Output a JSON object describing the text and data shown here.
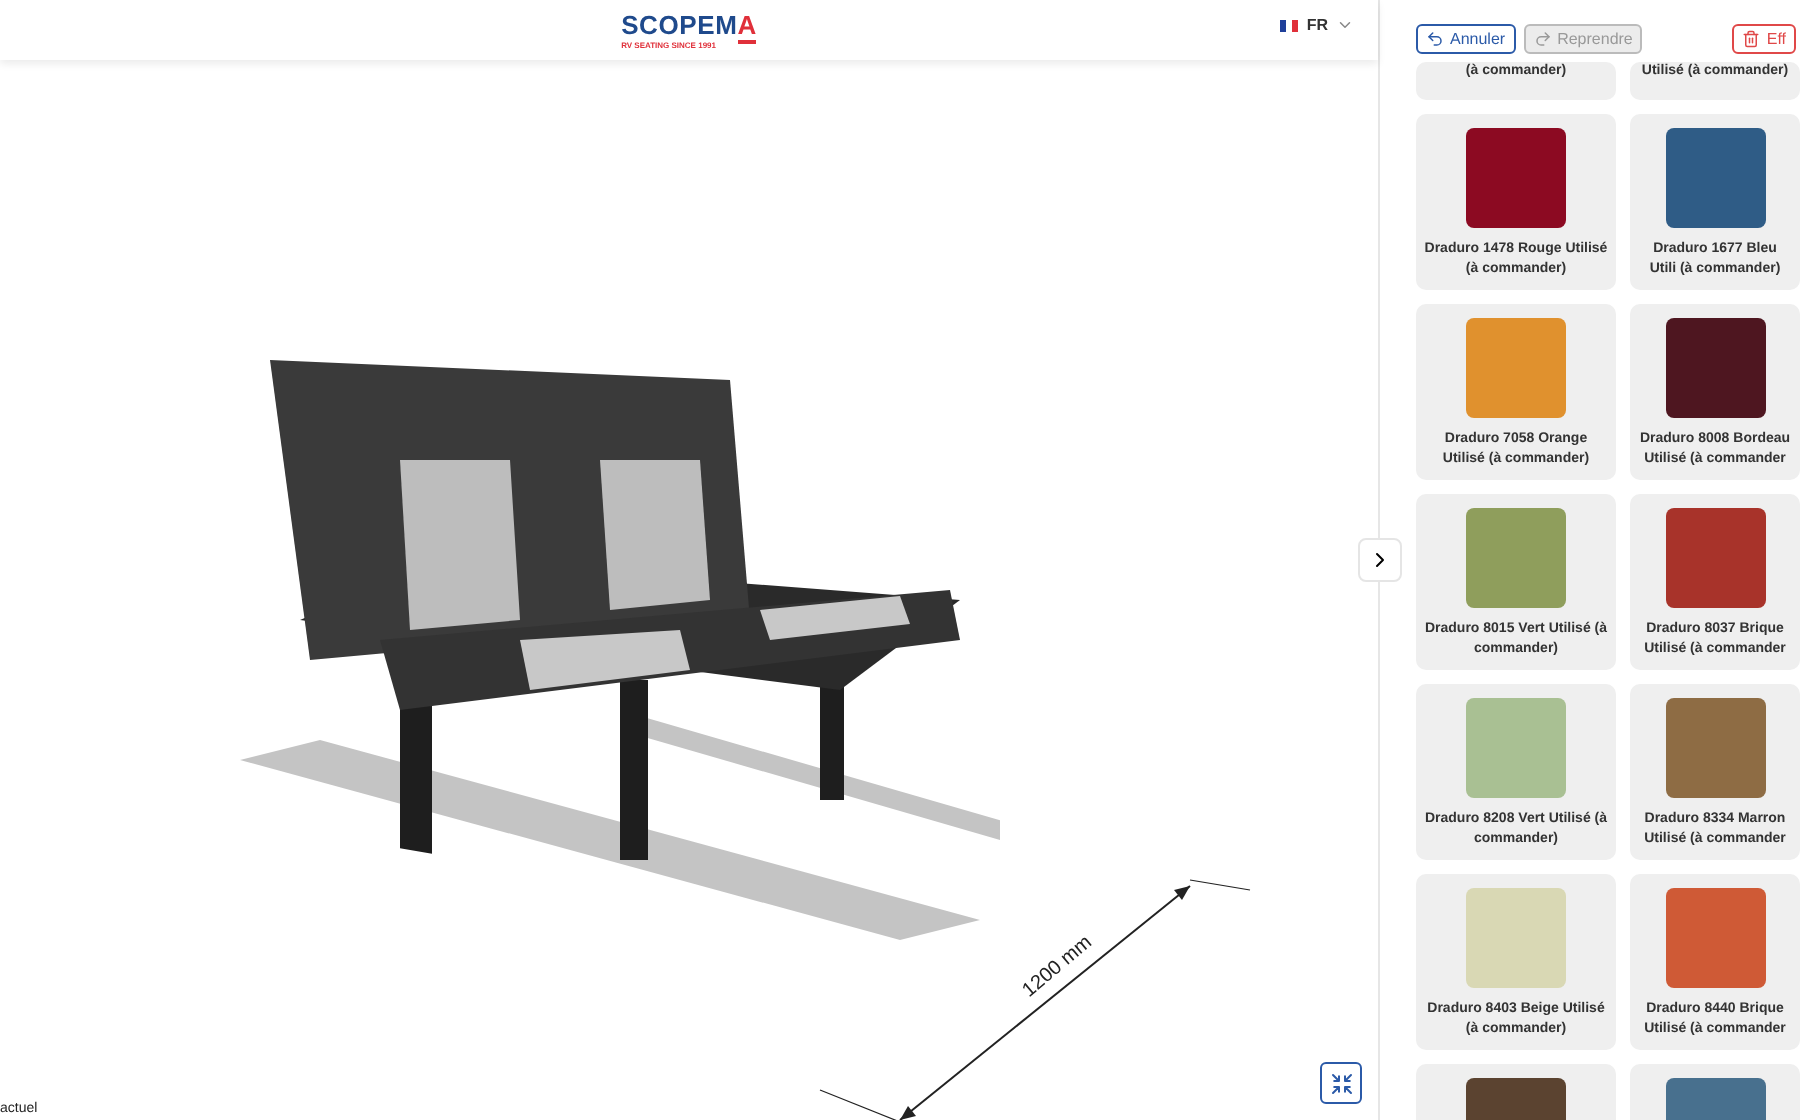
{
  "header": {
    "logo": {
      "main": "SCOPEM",
      "accent": "A",
      "tagline": "RV SEATING SINCE 1991"
    },
    "language": "FR"
  },
  "viewer": {
    "dimension": "1200 mm",
    "footer_note": "actuel"
  },
  "toolbar": {
    "buttons": [
      {
        "kind": "undo",
        "label": "Annuler",
        "disabled": false
      },
      {
        "kind": "redo",
        "label": "Reprendre",
        "disabled": true
      },
      {
        "kind": "delete",
        "label": "Eff",
        "disabled": false
      }
    ]
  },
  "swatches_partial": [
    "(à commander)",
    "Utilisé (à commander)"
  ],
  "swatches": [
    {
      "name": "Draduro 1478 Rouge Utilisé (à commander)",
      "color": "#8c0a22"
    },
    {
      "name": "Draduro 1677 Bleu Utili (à commander)",
      "color": "#2f5c86"
    },
    {
      "name": "Draduro 7058 Orange Utilisé (à commander)",
      "color": "#e0912e"
    },
    {
      "name": "Draduro 8008 Bordeau Utilisé (à commander",
      "color": "#4e1620"
    },
    {
      "name": "Draduro 8015 Vert Utilisé (à commander)",
      "color": "#8f9e5c"
    },
    {
      "name": "Draduro 8037 Brique Utilisé (à commander",
      "color": "#a8332a"
    },
    {
      "name": "Draduro 8208 Vert Utilisé (à commander)",
      "color": "#a9c093"
    },
    {
      "name": "Draduro 8334 Marron Utilisé (à commander",
      "color": "#8e6c44"
    },
    {
      "name": "Draduro 8403 Beige Utilisé (à commander)",
      "color": "#d9d8b4"
    },
    {
      "name": "Draduro 8440 Brique Utilisé (à commander",
      "color": "#cf5a36"
    },
    {
      "color": "#5b4330"
    },
    {
      "color": "#48708e"
    }
  ]
}
